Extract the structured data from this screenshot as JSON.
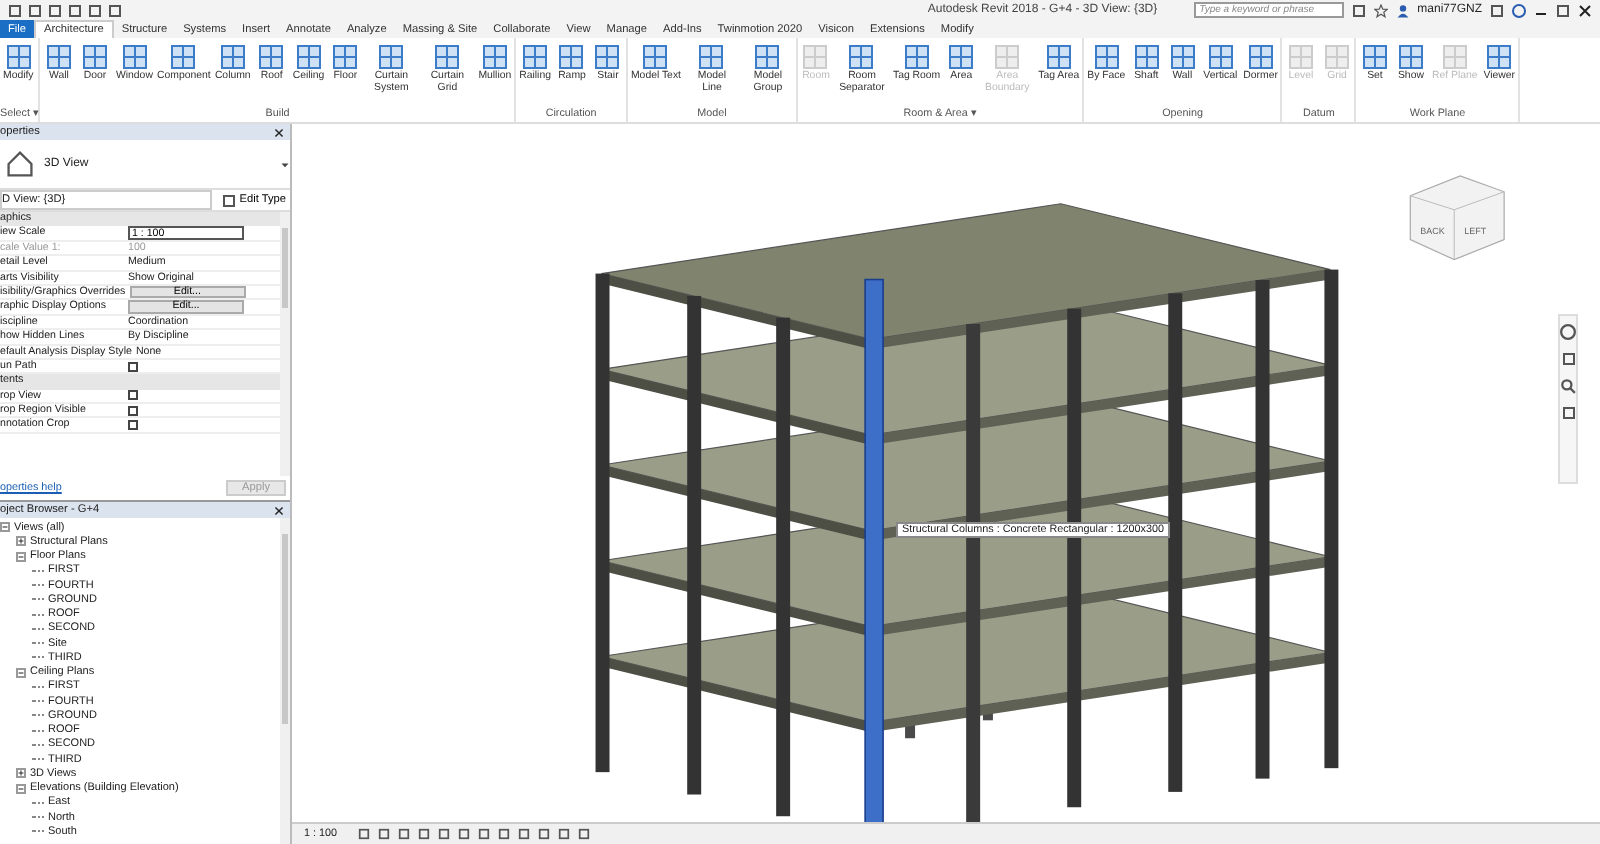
{
  "title_bar": {
    "title": "Autodesk Revit 2018 -  G+4 - 3D View: {3D}",
    "search_placeholder": "Type a keyword or phrase",
    "user": "mani77GNZ"
  },
  "tabs": [
    {
      "label": "File",
      "kind": "app",
      "selected": false
    },
    {
      "label": "Architecture",
      "kind": "tab",
      "selected": true
    },
    {
      "label": "Structure",
      "kind": "tab",
      "selected": false
    },
    {
      "label": "Systems",
      "kind": "tab",
      "selected": false
    },
    {
      "label": "Insert",
      "kind": "tab",
      "selected": false
    },
    {
      "label": "Annotate",
      "kind": "tab",
      "selected": false
    },
    {
      "label": "Analyze",
      "kind": "tab",
      "selected": false
    },
    {
      "label": "Massing & Site",
      "kind": "tab",
      "selected": false
    },
    {
      "label": "Collaborate",
      "kind": "tab",
      "selected": false
    },
    {
      "label": "View",
      "kind": "tab",
      "selected": false
    },
    {
      "label": "Manage",
      "kind": "tab",
      "selected": false
    },
    {
      "label": "Add-Ins",
      "kind": "tab",
      "selected": false
    },
    {
      "label": "Twinmotion 2020",
      "kind": "tab",
      "selected": false
    },
    {
      "label": "Visicon",
      "kind": "tab",
      "selected": false
    },
    {
      "label": "Extensions",
      "kind": "tab",
      "selected": false
    },
    {
      "label": "Modify",
      "kind": "tab",
      "selected": false
    }
  ],
  "ribbon": {
    "panels": [
      {
        "label": "Select ▾",
        "tools": [
          {
            "label": "Modify",
            "disabled": false
          }
        ]
      },
      {
        "label": "Build",
        "tools": [
          {
            "label": "Wall",
            "disabled": false
          },
          {
            "label": "Door",
            "disabled": false
          },
          {
            "label": "Window",
            "disabled": false
          },
          {
            "label": "Component",
            "disabled": false
          },
          {
            "label": "Column",
            "disabled": false
          },
          {
            "label": "Roof",
            "disabled": false
          },
          {
            "label": "Ceiling",
            "disabled": false
          },
          {
            "label": "Floor",
            "disabled": false
          },
          {
            "label": "Curtain System",
            "disabled": false
          },
          {
            "label": "Curtain Grid",
            "disabled": false
          },
          {
            "label": "Mullion",
            "disabled": false
          }
        ]
      },
      {
        "label": "Circulation",
        "tools": [
          {
            "label": "Railing",
            "disabled": false
          },
          {
            "label": "Ramp",
            "disabled": false
          },
          {
            "label": "Stair",
            "disabled": false
          }
        ]
      },
      {
        "label": "Model",
        "tools": [
          {
            "label": "Model Text",
            "disabled": false
          },
          {
            "label": "Model Line",
            "disabled": false
          },
          {
            "label": "Model Group",
            "disabled": false
          }
        ]
      },
      {
        "label": "Room & Area ▾",
        "tools": [
          {
            "label": "Room",
            "disabled": true
          },
          {
            "label": "Room Separator",
            "disabled": false
          },
          {
            "label": "Tag Room",
            "disabled": false
          },
          {
            "label": "Area",
            "disabled": false
          },
          {
            "label": "Area Boundary",
            "disabled": true
          },
          {
            "label": "Tag Area",
            "disabled": false
          }
        ]
      },
      {
        "label": "Opening",
        "tools": [
          {
            "label": "By Face",
            "disabled": false
          },
          {
            "label": "Shaft",
            "disabled": false
          },
          {
            "label": "Wall",
            "disabled": false
          },
          {
            "label": "Vertical",
            "disabled": false
          },
          {
            "label": "Dormer",
            "disabled": false
          }
        ]
      },
      {
        "label": "Datum",
        "tools": [
          {
            "label": "Level",
            "disabled": true
          },
          {
            "label": "Grid",
            "disabled": true
          }
        ]
      },
      {
        "label": "Work Plane",
        "tools": [
          {
            "label": "Set",
            "disabled": false
          },
          {
            "label": "Show",
            "disabled": false
          },
          {
            "label": "Ref Plane",
            "disabled": true
          },
          {
            "label": "Viewer",
            "disabled": false
          }
        ]
      }
    ]
  },
  "properties": {
    "title": "operties",
    "type_name": "3D View",
    "selector": "D View: {3D}",
    "edit_type": "Edit Type",
    "sections": [
      {
        "label": "aphics",
        "rows": [
          {
            "kind": "field",
            "name": "iew Scale",
            "value": "1 : 100"
          },
          {
            "kind": "readonly",
            "name": "cale Value    1:",
            "value": "100"
          },
          {
            "kind": "text",
            "name": "etail Level",
            "value": "Medium"
          },
          {
            "kind": "text",
            "name": "arts Visibility",
            "value": "Show Original"
          },
          {
            "kind": "button",
            "name": "isibility/Graphics Overrides",
            "value": "Edit..."
          },
          {
            "kind": "button",
            "name": "raphic Display Options",
            "value": "Edit..."
          },
          {
            "kind": "text",
            "name": "iscipline",
            "value": "Coordination"
          },
          {
            "kind": "text",
            "name": "how Hidden Lines",
            "value": "By Discipline"
          },
          {
            "kind": "text",
            "name": "efault Analysis Display Style",
            "value": "None"
          },
          {
            "kind": "checkbox",
            "name": "un Path",
            "checked": false
          }
        ]
      },
      {
        "label": "tents",
        "rows": [
          {
            "kind": "checkbox",
            "name": "rop View",
            "checked": false
          },
          {
            "kind": "checkbox",
            "name": "rop Region Visible",
            "checked": false
          },
          {
            "kind": "checkbox",
            "name": "nnotation Crop",
            "checked": false
          }
        ]
      }
    ],
    "help_link": "operties help",
    "apply": "Apply"
  },
  "browser": {
    "title": "oject Browser - G+4",
    "tree": [
      {
        "label": "Views (all)",
        "expanded": true,
        "children": [
          {
            "label": "Structural Plans",
            "expanded": false
          },
          {
            "label": "Floor Plans",
            "expanded": true,
            "children": [
              {
                "label": "FIRST"
              },
              {
                "label": "FOURTH"
              },
              {
                "label": "GROUND"
              },
              {
                "label": "ROOF"
              },
              {
                "label": "SECOND"
              },
              {
                "label": "Site"
              },
              {
                "label": "THIRD"
              }
            ]
          },
          {
            "label": "Ceiling Plans",
            "expanded": true,
            "children": [
              {
                "label": "FIRST"
              },
              {
                "label": "FOURTH"
              },
              {
                "label": "GROUND"
              },
              {
                "label": "ROOF"
              },
              {
                "label": "SECOND"
              },
              {
                "label": "THIRD"
              }
            ]
          },
          {
            "label": "3D Views",
            "expanded": false
          },
          {
            "label": "Elevations (Building Elevation)",
            "expanded": true,
            "children": [
              {
                "label": "East"
              },
              {
                "label": "North"
              },
              {
                "label": "South"
              }
            ]
          }
        ]
      }
    ]
  },
  "viewport": {
    "tooltip": "Structural Columns : Concrete Rectangular : 1200x300",
    "view_cube": [
      "BACK",
      "LEFT"
    ],
    "scale": "1 : 100"
  }
}
